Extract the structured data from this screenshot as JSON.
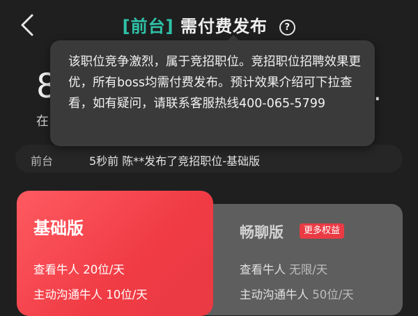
{
  "header": {
    "tag": "[前台]",
    "title": "需付费发布",
    "help_icon": "?"
  },
  "background": {
    "big_digit": "8",
    "big_right": ".",
    "small_char": "在"
  },
  "tooltip": {
    "text": "该职位竞争激烈，属于竞招职位。竞招职位招聘效果更优，所有boss均需付费发布。预计效果介绍可下拉查看，如有疑问，请联系客服热线400-065-5799"
  },
  "ticker": {
    "label": "前台",
    "message": "5秒前 陈**发布了竞招职位-基础版"
  },
  "plans": {
    "basic": {
      "name": "基础版",
      "feature1_label": "查看牛人 ",
      "feature1_value": "20位/天",
      "feature2_label": "主动沟通牛人 ",
      "feature2_value": "10位/天"
    },
    "chat": {
      "name": "畅聊版",
      "badge": "更多权益",
      "feature1_label": "查看牛人 ",
      "feature1_value": "无限/天",
      "feature2_label": "主动沟通牛人 ",
      "feature2_value": "50位/天"
    }
  },
  "icons": {
    "back": "chevron-left-icon",
    "help": "question-circle-icon"
  },
  "colors": {
    "accent_teal": "#2fc3a8",
    "brand_red": "#f03b44",
    "background": "#1f1f1f"
  }
}
